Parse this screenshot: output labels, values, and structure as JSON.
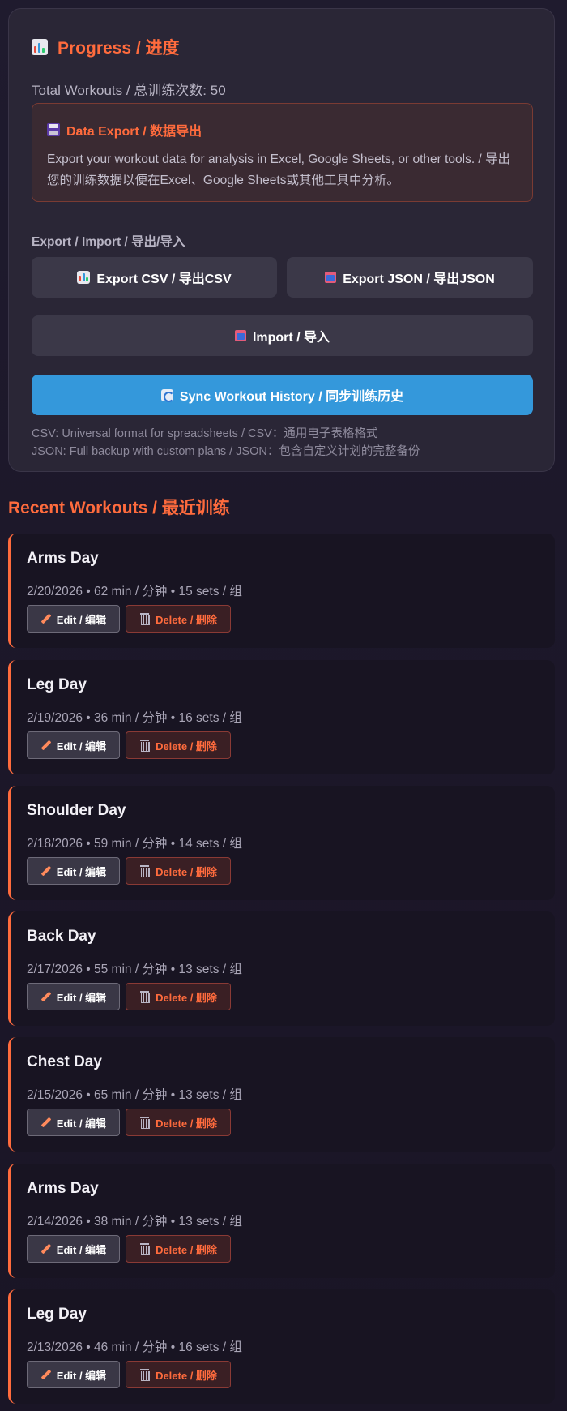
{
  "progress": {
    "title": "Progress / 进度",
    "total_label": "Total Workouts / 总训练次数: 50"
  },
  "export_box": {
    "title": "Data Export / 数据导出",
    "description": "Export your workout data for analysis in Excel, Google Sheets, or other tools. / 导出您的训练数据以便在Excel、Google Sheets或其他工具中分析。"
  },
  "export_import": {
    "section_label": "Export / Import / 导出/导入",
    "csv_label": "Export CSV / 导出CSV",
    "json_label": "Export JSON / 导出JSON",
    "import_label": "Import / 导入",
    "sync_label": "Sync Workout History / 同步训练历史",
    "csv_note": "CSV: Universal format for spreadsheets / CSV：通用电子表格格式",
    "json_note": "JSON: Full backup with custom plans / JSON：包含自定义计划的完整备份"
  },
  "recent": {
    "title": "Recent Workouts / 最近训练",
    "edit_label": "Edit / 编辑",
    "delete_label": "Delete / 删除",
    "workouts": [
      {
        "name": "Arms Day",
        "meta": "2/20/2026 • 62 min / 分钟 • 15 sets / 组"
      },
      {
        "name": "Leg Day",
        "meta": "2/19/2026 • 36 min / 分钟 • 16 sets / 组"
      },
      {
        "name": "Shoulder Day",
        "meta": "2/18/2026 • 59 min / 分钟 • 14 sets / 组"
      },
      {
        "name": "Back Day",
        "meta": "2/17/2026 • 55 min / 分钟 • 13 sets / 组"
      },
      {
        "name": "Chest Day",
        "meta": "2/15/2026 • 65 min / 分钟 • 13 sets / 组"
      },
      {
        "name": "Arms Day",
        "meta": "2/14/2026 • 38 min / 分钟 • 13 sets / 组"
      },
      {
        "name": "Leg Day",
        "meta": "2/13/2026 • 46 min / 分钟 • 16 sets / 组"
      }
    ]
  },
  "colors": {
    "accent": "#ff6b3d",
    "sync_button": "#3498db",
    "card_bg": "#2a2636",
    "workout_bg": "#181422"
  }
}
